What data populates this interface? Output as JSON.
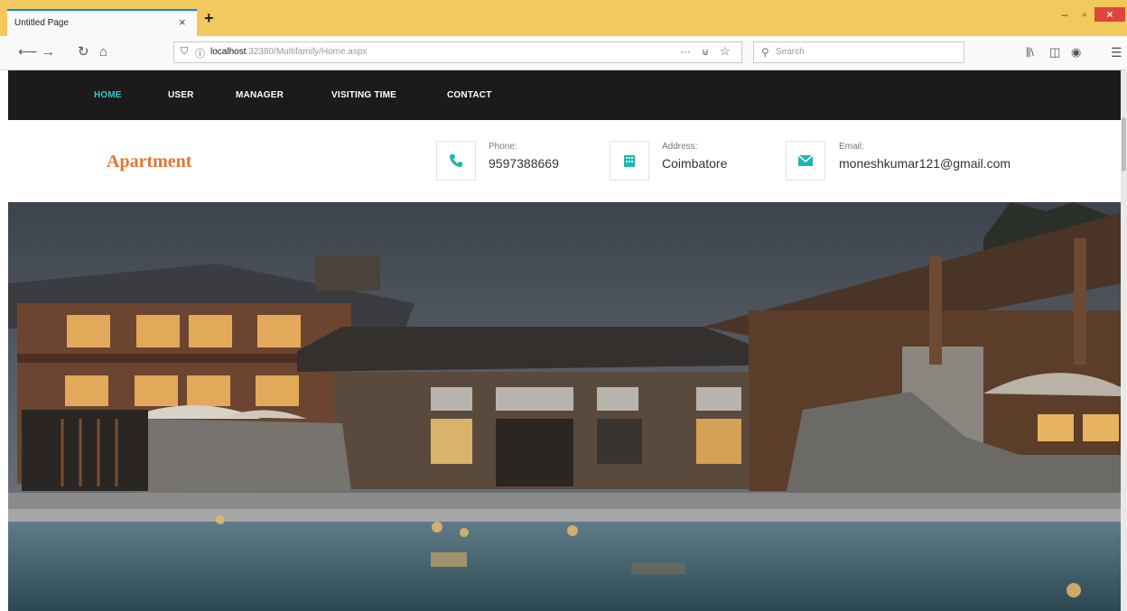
{
  "browser": {
    "tab_title": "Untitled Page",
    "tab_close": "×",
    "new_tab": "+",
    "window_min": "–",
    "window_max": "▫",
    "window_close": "×",
    "url_host": "localhost",
    "url_path": ":32380/Multifamily/Home.aspx",
    "page_actions": "···",
    "search_placeholder": "Search"
  },
  "nav": {
    "items": [
      {
        "label": "HOME",
        "active": true
      },
      {
        "label": "USER",
        "active": false
      },
      {
        "label": "MANAGER",
        "active": false
      },
      {
        "label": "VISITING TIME",
        "active": false
      },
      {
        "label": "CONTACT",
        "active": false
      }
    ],
    "active_color": "#2cc8c5"
  },
  "header": {
    "brand": "Apartment",
    "brand_color": "#e8742f",
    "contacts": [
      {
        "icon": "phone-icon",
        "label": "Phone:",
        "value": "9597388669"
      },
      {
        "icon": "building-icon",
        "label": "Address:",
        "value": "Coimbatore"
      },
      {
        "icon": "envelope-icon",
        "label": "Email:",
        "value": "moneshkumar121@gmail.com"
      }
    ],
    "icon_color": "#1fb5b2"
  }
}
